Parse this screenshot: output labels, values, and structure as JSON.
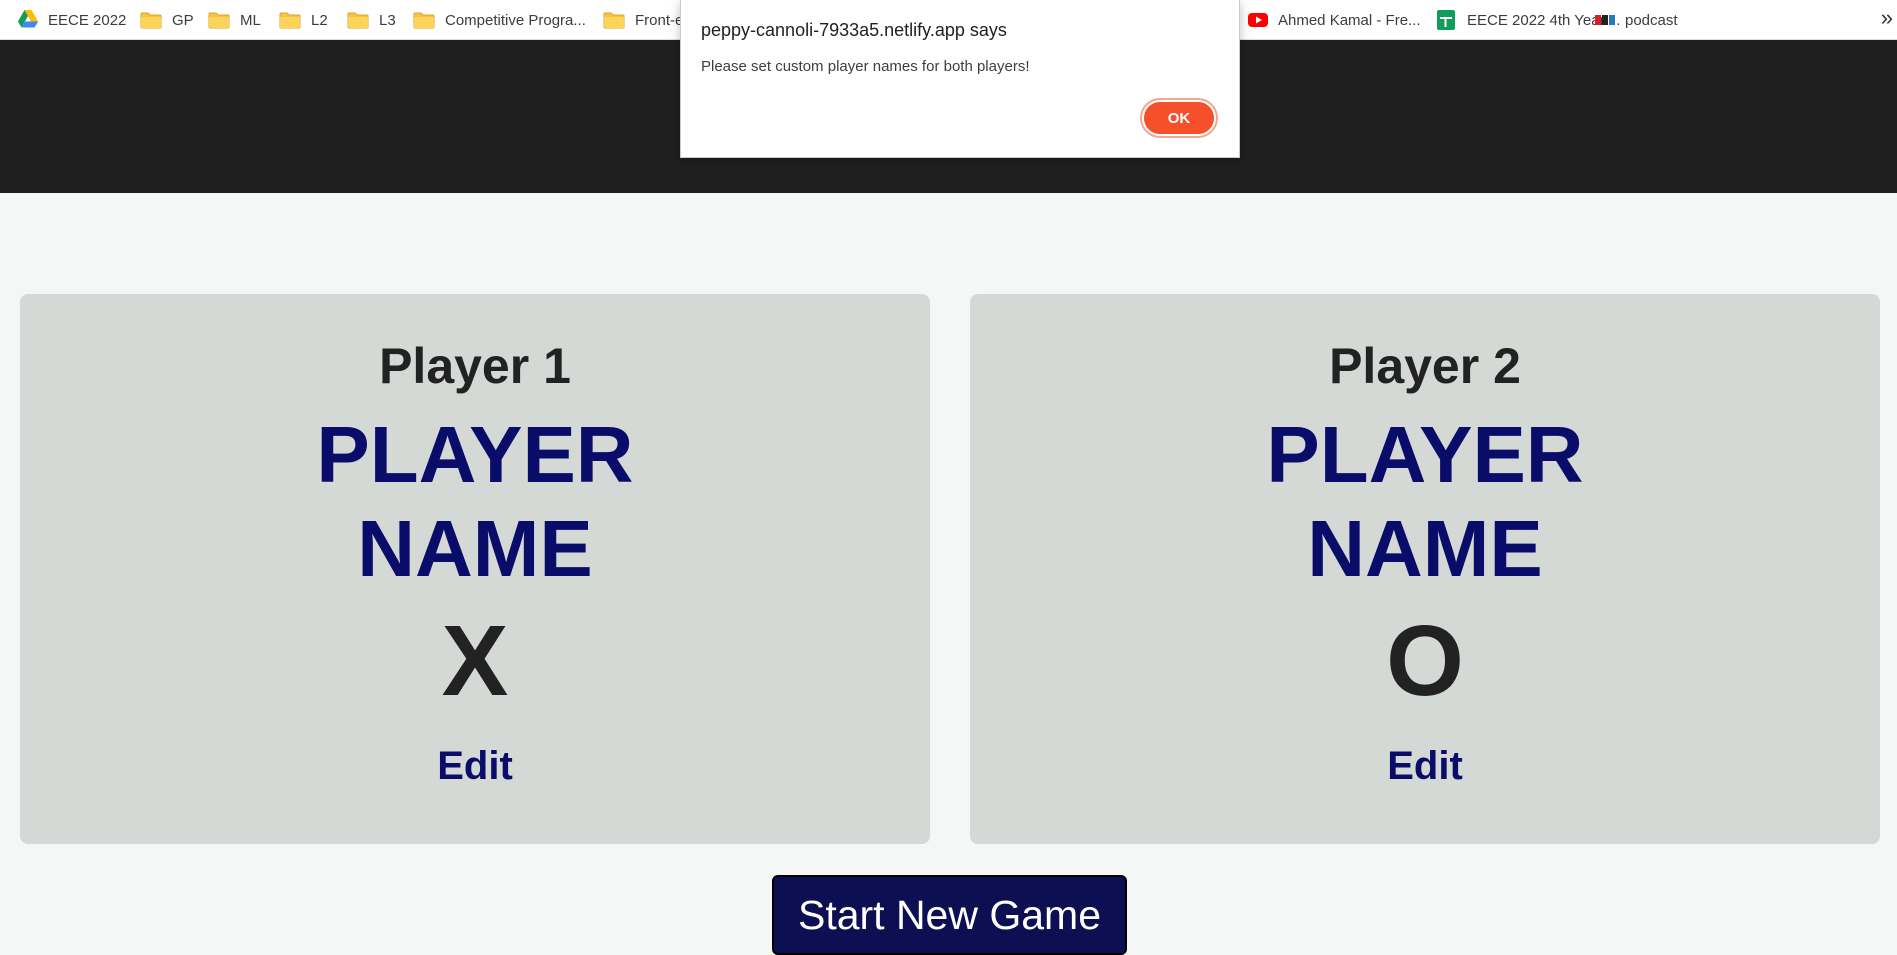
{
  "bookmarks_bar": {
    "items": [
      {
        "label": "EECE 2022",
        "icon": "google-drive-icon"
      },
      {
        "label": "GP",
        "icon": "folder-icon"
      },
      {
        "label": "ML",
        "icon": "folder-icon"
      },
      {
        "label": "L2",
        "icon": "folder-icon"
      },
      {
        "label": "L3",
        "icon": "folder-icon"
      },
      {
        "label": "Competitive Progra...",
        "icon": "folder-icon"
      },
      {
        "label": "Front-e",
        "icon": "folder-icon"
      },
      {
        "label": "Ahmed Kamal - Fre...",
        "icon": "youtube-icon"
      },
      {
        "label": "EECE 2022 4th Year....",
        "icon": "google-sheets-icon"
      },
      {
        "label": "podcast",
        "icon": "npr-icon"
      }
    ],
    "overflow": "»"
  },
  "alert": {
    "title": "peppy-cannoli-7933a5.netlify.app says",
    "message": "Please set custom player names for both players!",
    "ok_label": "OK"
  },
  "players": [
    {
      "heading": "Player 1",
      "name_line1": "PLAYER",
      "name_line2": "NAME",
      "symbol": "X",
      "edit_label": "Edit"
    },
    {
      "heading": "Player 2",
      "name_line1": "PLAYER",
      "name_line2": "NAME",
      "symbol": "O",
      "edit_label": "Edit"
    }
  ],
  "start_button_label": "Start New Game",
  "colors": {
    "header_bg": "#1f1f1f",
    "page_bg": "#f5f7f6",
    "card_bg": "#d5d9d6",
    "accent_navy": "#0a0c6a",
    "ok_button": "#f5502a"
  }
}
